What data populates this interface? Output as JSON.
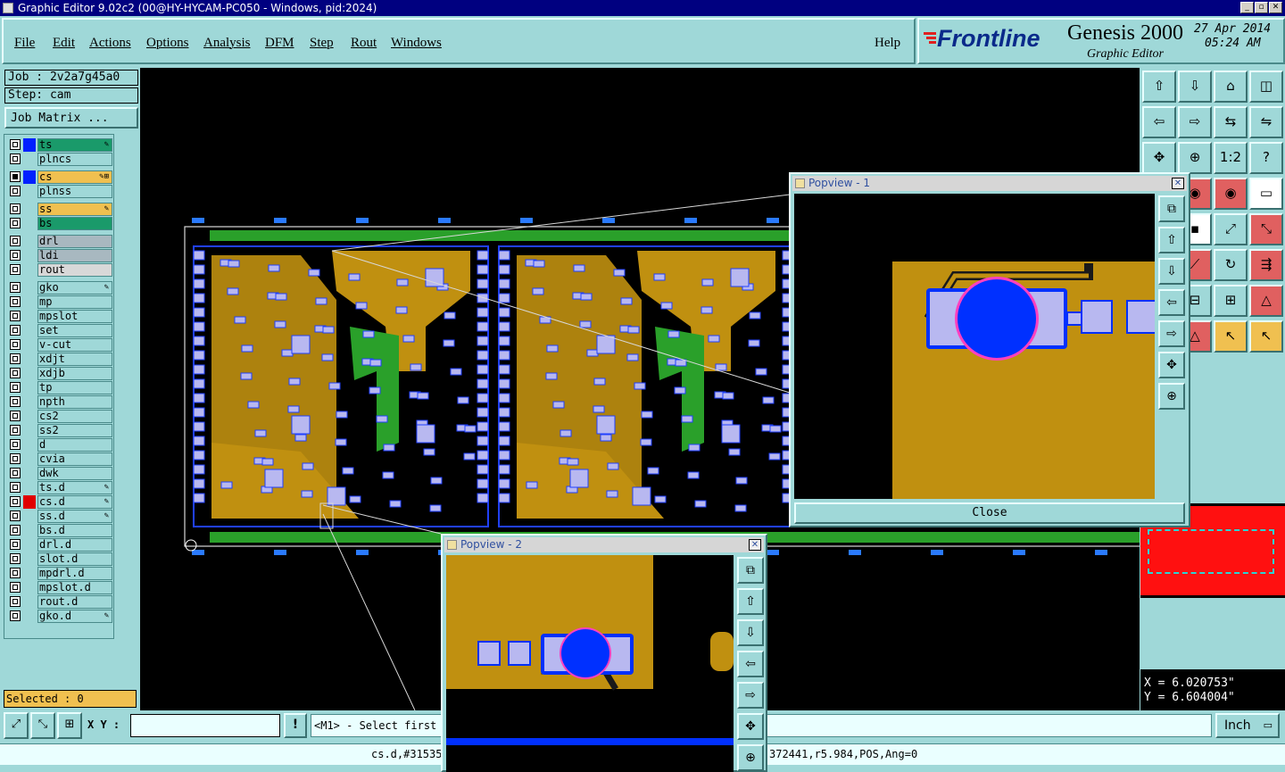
{
  "window": {
    "title": "Graphic Editor 9.02c2 (00@HY-HYCAM-PC050 - Windows, pid:2024)",
    "min": "_",
    "max": "▫",
    "close": "✕"
  },
  "menu": {
    "file": "File",
    "edit": "Edit",
    "actions": "Actions",
    "options": "Options",
    "analysis": "Analysis",
    "dfm": "DFM",
    "step": "Step",
    "rout": "Rout",
    "windows": "Windows",
    "help": "Help"
  },
  "brand": {
    "logo": "Frontline",
    "product": "Genesis 2000",
    "subtitle": "Graphic Editor",
    "date": "27 Apr 2014",
    "time": "05:24 AM"
  },
  "job": {
    "job_line": "Job : 2v2a7g45a0",
    "step_line": "Step: cam",
    "matrix_button": "Job Matrix ..."
  },
  "layers": [
    {
      "name": "ts",
      "color": "#1a9a6a",
      "swatch": "#0020ff",
      "mark": "✎"
    },
    {
      "name": "plncs",
      "color": "#9fd8d8",
      "swatch": "",
      "mark": ""
    },
    {
      "name": "cs",
      "color": "#f0c050",
      "swatch": "#0020ff",
      "mark": "✎⊞"
    },
    {
      "name": "plnss",
      "color": "#9fd8d8",
      "swatch": "",
      "mark": ""
    },
    {
      "name": "ss",
      "color": "#f0c050",
      "swatch": "",
      "mark": "✎"
    },
    {
      "name": "bs",
      "color": "#1a9a6a",
      "swatch": "",
      "mark": ""
    },
    {
      "name": "drl",
      "color": "#a8b8c0",
      "swatch": "",
      "mark": ""
    },
    {
      "name": "ldi",
      "color": "#a8b8c0",
      "swatch": "",
      "mark": ""
    },
    {
      "name": "rout",
      "color": "#d8d8d8",
      "swatch": "",
      "mark": ""
    },
    {
      "name": "gko",
      "color": "#9fd8d8",
      "swatch": "",
      "mark": "✎"
    },
    {
      "name": "mp",
      "color": "#9fd8d8",
      "swatch": "",
      "mark": ""
    },
    {
      "name": "mpslot",
      "color": "#9fd8d8",
      "swatch": "",
      "mark": ""
    },
    {
      "name": "set",
      "color": "#9fd8d8",
      "swatch": "",
      "mark": ""
    },
    {
      "name": "v-cut",
      "color": "#9fd8d8",
      "swatch": "",
      "mark": ""
    },
    {
      "name": "xdjt",
      "color": "#9fd8d8",
      "swatch": "",
      "mark": ""
    },
    {
      "name": "xdjb",
      "color": "#9fd8d8",
      "swatch": "",
      "mark": ""
    },
    {
      "name": "tp",
      "color": "#9fd8d8",
      "swatch": "",
      "mark": ""
    },
    {
      "name": "npth",
      "color": "#9fd8d8",
      "swatch": "",
      "mark": ""
    },
    {
      "name": "cs2",
      "color": "#9fd8d8",
      "swatch": "",
      "mark": ""
    },
    {
      "name": "ss2",
      "color": "#9fd8d8",
      "swatch": "",
      "mark": ""
    },
    {
      "name": "d",
      "color": "#9fd8d8",
      "swatch": "",
      "mark": ""
    },
    {
      "name": "cvia",
      "color": "#9fd8d8",
      "swatch": "",
      "mark": ""
    },
    {
      "name": "dwk",
      "color": "#9fd8d8",
      "swatch": "",
      "mark": ""
    },
    {
      "name": "ts.d",
      "color": "#9fd8d8",
      "swatch": "",
      "mark": "✎"
    },
    {
      "name": "cs.d",
      "color": "#9fd8d8",
      "swatch": "#e00000",
      "mark": "✎"
    },
    {
      "name": "ss.d",
      "color": "#9fd8d8",
      "swatch": "",
      "mark": "✎"
    },
    {
      "name": "bs.d",
      "color": "#9fd8d8",
      "swatch": "",
      "mark": ""
    },
    {
      "name": "drl.d",
      "color": "#9fd8d8",
      "swatch": "",
      "mark": ""
    },
    {
      "name": "slot.d",
      "color": "#9fd8d8",
      "swatch": "",
      "mark": ""
    },
    {
      "name": "mpdrl.d",
      "color": "#9fd8d8",
      "swatch": "",
      "mark": ""
    },
    {
      "name": "mpslot.d",
      "color": "#9fd8d8",
      "swatch": "",
      "mark": ""
    },
    {
      "name": "rout.d",
      "color": "#9fd8d8",
      "swatch": "",
      "mark": ""
    },
    {
      "name": "gko.d",
      "color": "#9fd8d8",
      "swatch": "",
      "mark": "✎"
    }
  ],
  "selected": "Selected : 0",
  "tools": {
    "buttons": [
      "⇧",
      "⇩",
      "⌂",
      "◫",
      "⇦",
      "⇨",
      "⇆",
      "⇋",
      "✥",
      "⊕",
      "1:2",
      "?",
      "↯",
      "◉",
      "◉",
      "▭",
      "▦",
      "▪",
      "⤢",
      "⤡",
      "⤡",
      "⟋",
      "↻",
      "⇶",
      "⎯",
      "⊟",
      "⊞",
      "△",
      "△",
      "△",
      "↖",
      "↖",
      "⌖"
    ]
  },
  "coords": {
    "x": "X = 6.020753\"",
    "y": "Y = 6.604004\""
  },
  "status": {
    "xy_label": "X Y :",
    "xy_value": "",
    "prompt": "<M1> - Select first",
    "units": "Inch",
    "units_arrow": "▭"
  },
  "info": {
    "left": "cs.d,#31535",
    "right": "372441,r5.984,POS,Ang=0"
  },
  "popview1": {
    "title": "Popview - 1",
    "close_label": "Close",
    "x": "✕"
  },
  "popview2": {
    "title": "Popview - 2",
    "x": "✕"
  }
}
